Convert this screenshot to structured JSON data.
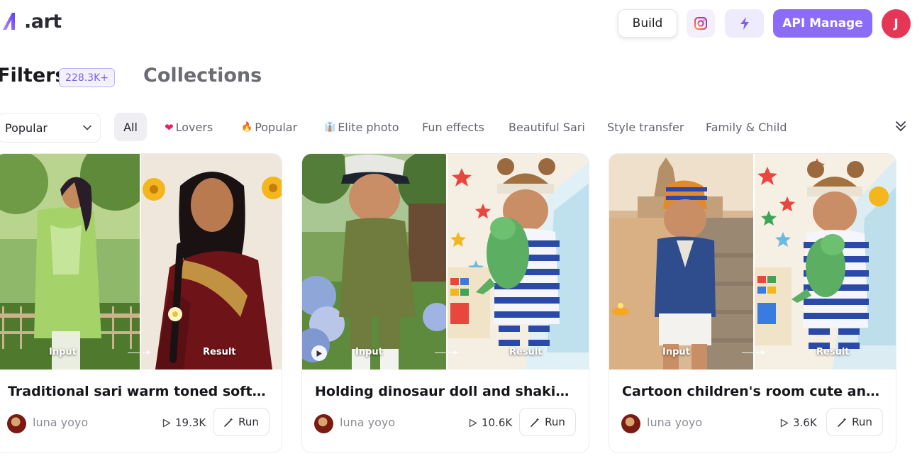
{
  "header": {
    "logo_text": ".art",
    "build_label": "Build",
    "api_label": "API Manage",
    "avatar_initial": "J",
    "icons": [
      "instagram-icon",
      "bolt-icon"
    ]
  },
  "filters": {
    "title": "Filters",
    "count": "228.3K+",
    "collections_label": "Collections",
    "sort_value": "Popular"
  },
  "categories": [
    {
      "label": "All",
      "emoji": ""
    },
    {
      "label": "Lovers",
      "emoji": "❤"
    },
    {
      "label": "Popular",
      "emoji": "🔥"
    },
    {
      "label": "Elite photo",
      "emoji": "👔"
    },
    {
      "label": "Fun effects",
      "emoji": ""
    },
    {
      "label": "Beautiful Sari",
      "emoji": ""
    },
    {
      "label": "Style transfer",
      "emoji": ""
    },
    {
      "label": "Family & Child",
      "emoji": ""
    }
  ],
  "cards": [
    {
      "title": "Traditional sari warm toned soft li...",
      "author": "luna yoyo",
      "views": "19.3K",
      "run_label": "Run",
      "input_label": "Input",
      "result_label": "Result"
    },
    {
      "title": "Holding dinosaur doll and shaking...",
      "author": "luna yoyo",
      "views": "10.6K",
      "run_label": "Run",
      "input_label": "Input",
      "result_label": "Result"
    },
    {
      "title": "Cartoon children's room cute and ...",
      "author": "luna yoyo",
      "views": "3.6K",
      "run_label": "Run",
      "input_label": "Input",
      "result_label": "Result"
    }
  ],
  "colors": {
    "accent": "#8b6cf6",
    "avatar": "#e63656",
    "badge_text": "#7d61e9"
  }
}
